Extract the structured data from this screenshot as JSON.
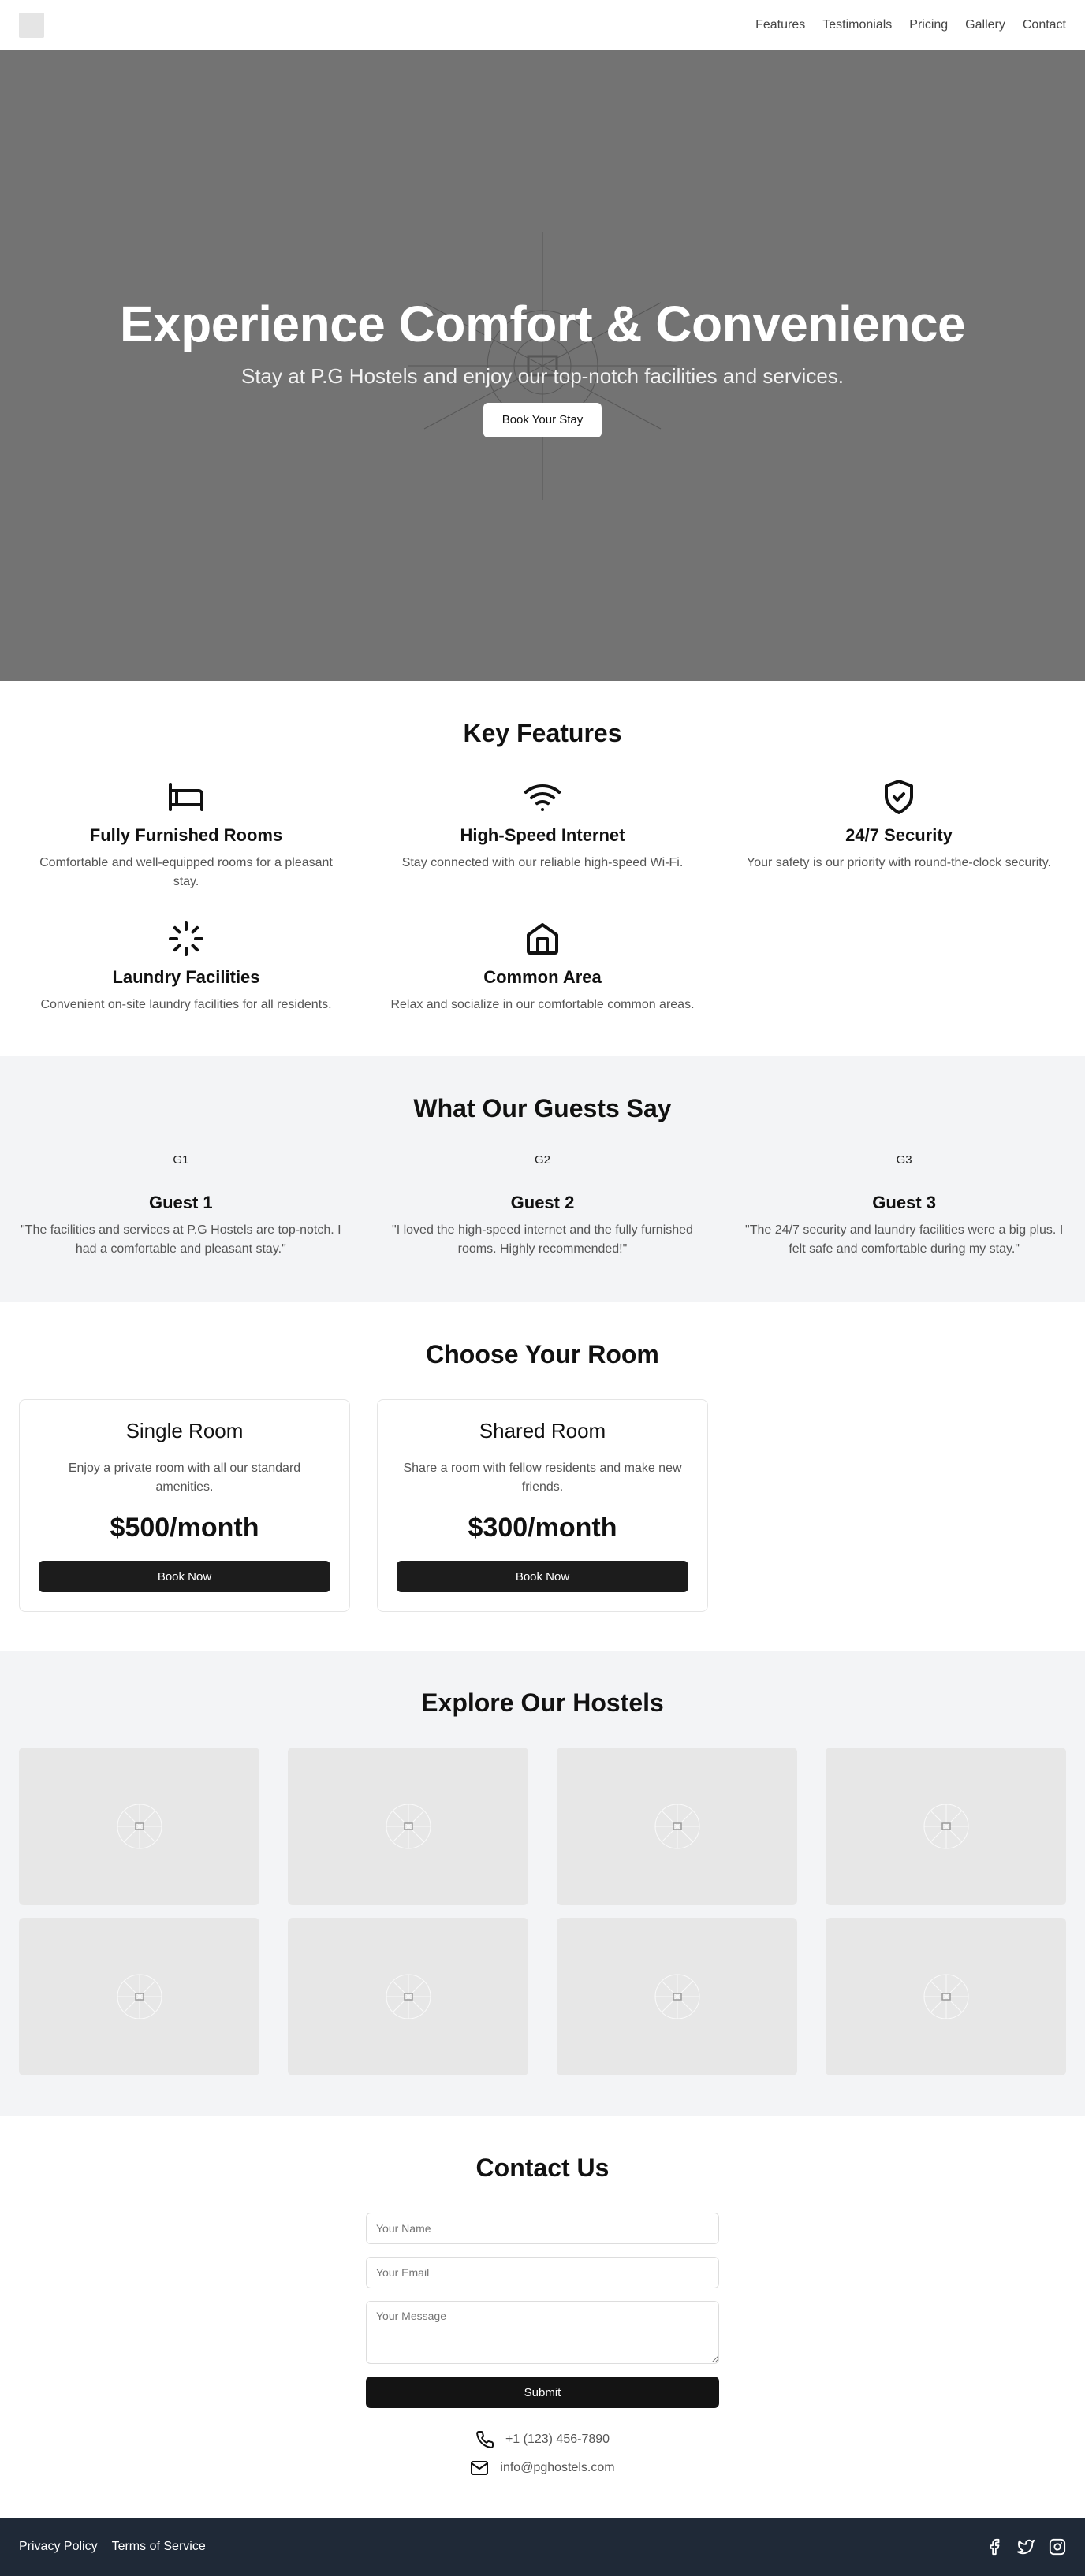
{
  "nav": {
    "items": [
      "Features",
      "Testimonials",
      "Pricing",
      "Gallery",
      "Contact"
    ]
  },
  "hero": {
    "title": "Experience Comfort & Convenience",
    "subtitle": "Stay at P.G Hostels and enjoy our top-notch facilities and services.",
    "cta": "Book Your Stay"
  },
  "features": {
    "title": "Key Features",
    "items": [
      {
        "icon": "bed-icon",
        "title": "Fully Furnished Rooms",
        "desc": "Comfortable and well-equipped rooms for a pleasant stay."
      },
      {
        "icon": "wifi-icon",
        "title": "High-Speed Internet",
        "desc": "Stay connected with our reliable high-speed Wi-Fi."
      },
      {
        "icon": "shield-check-icon",
        "title": "24/7 Security",
        "desc": "Your safety is our priority with round-the-clock security."
      },
      {
        "icon": "loader-icon",
        "title": "Laundry Facilities",
        "desc": "Convenient on-site laundry facilities for all residents."
      },
      {
        "icon": "home-icon",
        "title": "Common Area",
        "desc": "Relax and socialize in our comfortable common areas."
      }
    ]
  },
  "testimonials": {
    "title": "What Our Guests Say",
    "items": [
      {
        "avatar": "G1",
        "name": "Guest 1",
        "quote": "\"The facilities and services at P.G Hostels are top-notch. I had a comfortable and pleasant stay.\""
      },
      {
        "avatar": "G2",
        "name": "Guest 2",
        "quote": "\"I loved the high-speed internet and the fully furnished rooms. Highly recommended!\""
      },
      {
        "avatar": "G3",
        "name": "Guest 3",
        "quote": "\"The 24/7 security and laundry facilities were a big plus. I felt safe and comfortable during my stay.\""
      }
    ]
  },
  "pricing": {
    "title": "Choose Your Room",
    "items": [
      {
        "name": "Single Room",
        "desc": "Enjoy a private room with all our standard amenities.",
        "price": "$500/month",
        "cta": "Book Now"
      },
      {
        "name": "Shared Room",
        "desc": "Share a room with fellow residents and make new friends.",
        "price": "$300/month",
        "cta": "Book Now"
      }
    ]
  },
  "gallery": {
    "title": "Explore Our Hostels"
  },
  "contact": {
    "title": "Contact Us",
    "name_placeholder": "Your Name",
    "email_placeholder": "Your Email",
    "message_placeholder": "Your Message",
    "submit": "Submit",
    "phone": "+1 (123) 456-7890",
    "email": "info@pghostels.com"
  },
  "footer": {
    "privacy": "Privacy Policy",
    "terms": "Terms of Service"
  },
  "colors": {
    "hero_bg": "#737373",
    "footer_bg": "#1f2937",
    "button_dark": "#1c1c1c",
    "section_gray": "#f3f4f6"
  }
}
